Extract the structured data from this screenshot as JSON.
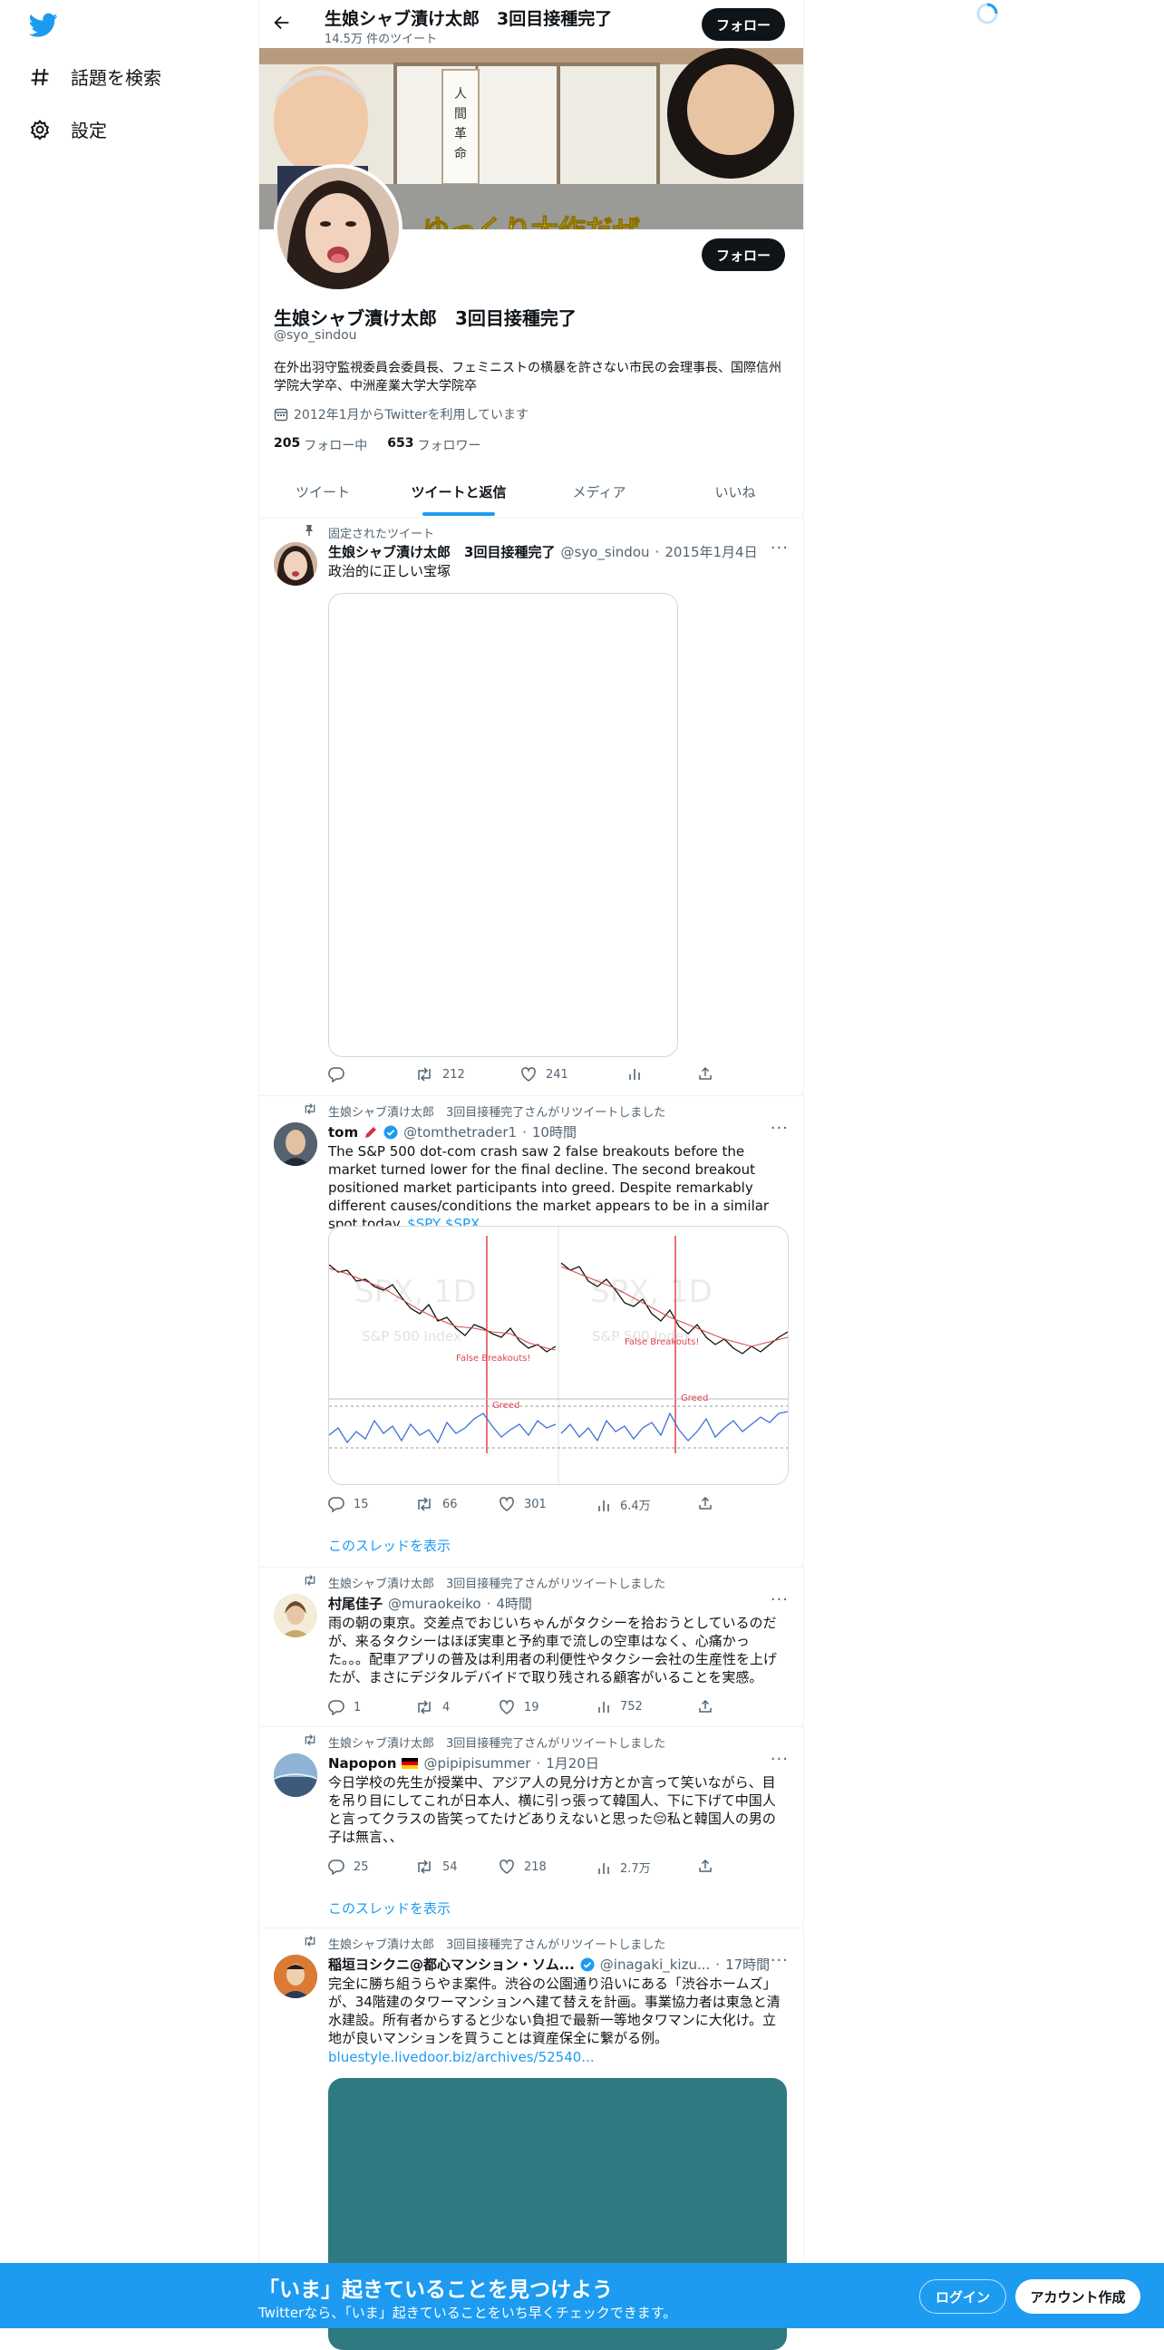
{
  "sidebar": {
    "items": [
      {
        "label": "話題を検索",
        "icon": "hashtag-icon"
      },
      {
        "label": "設定",
        "icon": "gear-icon"
      }
    ]
  },
  "header": {
    "title": "生娘シャブ漬け太郎　3回目接種完了",
    "tweet_count": "14.5万 件のツイート",
    "follow_label": "フォロー"
  },
  "banner": {
    "caption": "ゆっくり大作だぜ"
  },
  "profile": {
    "name": "生娘シャブ漬け太郎　3回目接種完了",
    "handle": "@syo_sindou",
    "bio": "在外出羽守監視委員会委員長、フェミニストの横暴を許さない市民の会理事長、国際信州学院大学卒、中洲産業大学大学院卒",
    "joined": "2012年1月からTwitterを利用しています",
    "following_count": "205",
    "following_label": "フォロー中",
    "followers_count": "653",
    "followers_label": "フォロワー",
    "follow_label": "フォロー"
  },
  "tabs": [
    {
      "label": "ツイート",
      "active": false
    },
    {
      "label": "ツイートと返信",
      "active": true
    },
    {
      "label": "メディア",
      "active": false
    },
    {
      "label": "いいね",
      "active": false
    }
  ],
  "tweets": [
    {
      "context": "固定されたツイート",
      "name": "生娘シャブ漬け太郎　3回目接種完了",
      "handle": "@syo_sindou",
      "time": "2015年1月4日",
      "text": "政治的に正しい宝塚",
      "replies": "",
      "retweets": "212",
      "likes": "241",
      "views": ""
    },
    {
      "context": "生娘シャブ漬け太郎　3回目接種完了さんがリツイートしました",
      "name": "tom",
      "handle": "@tomthetrader1",
      "time": "10時間",
      "text": "The S&P 500 dot-com crash saw 2 false breakouts before the market turned lower for the final decline. The second breakout positioned market participants into greed. Despite remarkably different causes/conditions the market appears to be in a similar spot today.",
      "cashtags": "$SPY $SPX",
      "replies": "15",
      "retweets": "66",
      "likes": "301",
      "views": "6.4万",
      "thread": "このスレッドを表示",
      "chart": {
        "left_watermark": "SPX, 1D",
        "left_sub": "S&P 500 Index",
        "left_tag": "False Breakouts!",
        "right_watermark": "SPX, 1D",
        "right_sub": "S&P 500 Index",
        "right_tag": "False Breakouts!",
        "greed": "Greed"
      }
    },
    {
      "context": "生娘シャブ漬け太郎　3回目接種完了さんがリツイートしました",
      "name": "村尾佳子",
      "handle": "@muraokeiko",
      "time": "4時間",
      "text": "雨の朝の東京。交差点でおじいちゃんがタクシーを拾おうとしているのだが、来るタクシーはほぼ実車と予約車で流しの空車はなく、心痛かった。。。配車アプリの普及は利用者の利便性やタクシー会社の生産性を上げたが、まさにデジタルデバイドで取り残される顧客がいることを実感。",
      "replies": "1",
      "retweets": "4",
      "likes": "19",
      "views": "752"
    },
    {
      "context": "生娘シャブ漬け太郎　3回目接種完了さんがリツイートしました",
      "name": "Napopon",
      "handle": "@pipipisummer",
      "time": "1月20日",
      "text": "今日学校の先生が授業中、アジア人の見分け方とか言って笑いながら、目を吊り目にしてこれが日本人、横に引っ張って韓国人、下に下げて中国人と言ってクラスの皆笑ってたけどありえないと思った😔私と韓国人の男の子は無言、、",
      "replies": "25",
      "retweets": "54",
      "likes": "218",
      "views": "2.7万",
      "thread": "このスレッドを表示"
    },
    {
      "context": "生娘シャブ漬け太郎　3回目接種完了さんがリツイートしました",
      "name": "稲垣ヨシクニ@都心マンション・ソム...",
      "handle": "@inagaki_kizu...",
      "time": "17時間",
      "text": "完全に勝ち組うらやま案件。渋谷の公園通り沿いにある「渋谷ホームズ」が、34階建のタワーマンションへ建て替えを計画。事業協力者は東急と清水建設。所有者からすると少ない負担で最新一等地タワマンに大化け。立地が良いマンションを買うことは資産保全に繋がる例。",
      "link": "bluestyle.livedoor.biz/archives/52540..."
    }
  ],
  "bottom_bar": {
    "title": "「いま」起きていることを見つけよう",
    "subtitle": "Twitterなら、「いま」起きていることをいち早くチェックできます。",
    "login_label": "ログイン",
    "signup_label": "アカウント作成"
  },
  "colors": {
    "accent": "#1d9bf0",
    "banner_bottom": "#8a8a8a",
    "teal_media": "#2e7a80",
    "dark": "#0f1419"
  }
}
